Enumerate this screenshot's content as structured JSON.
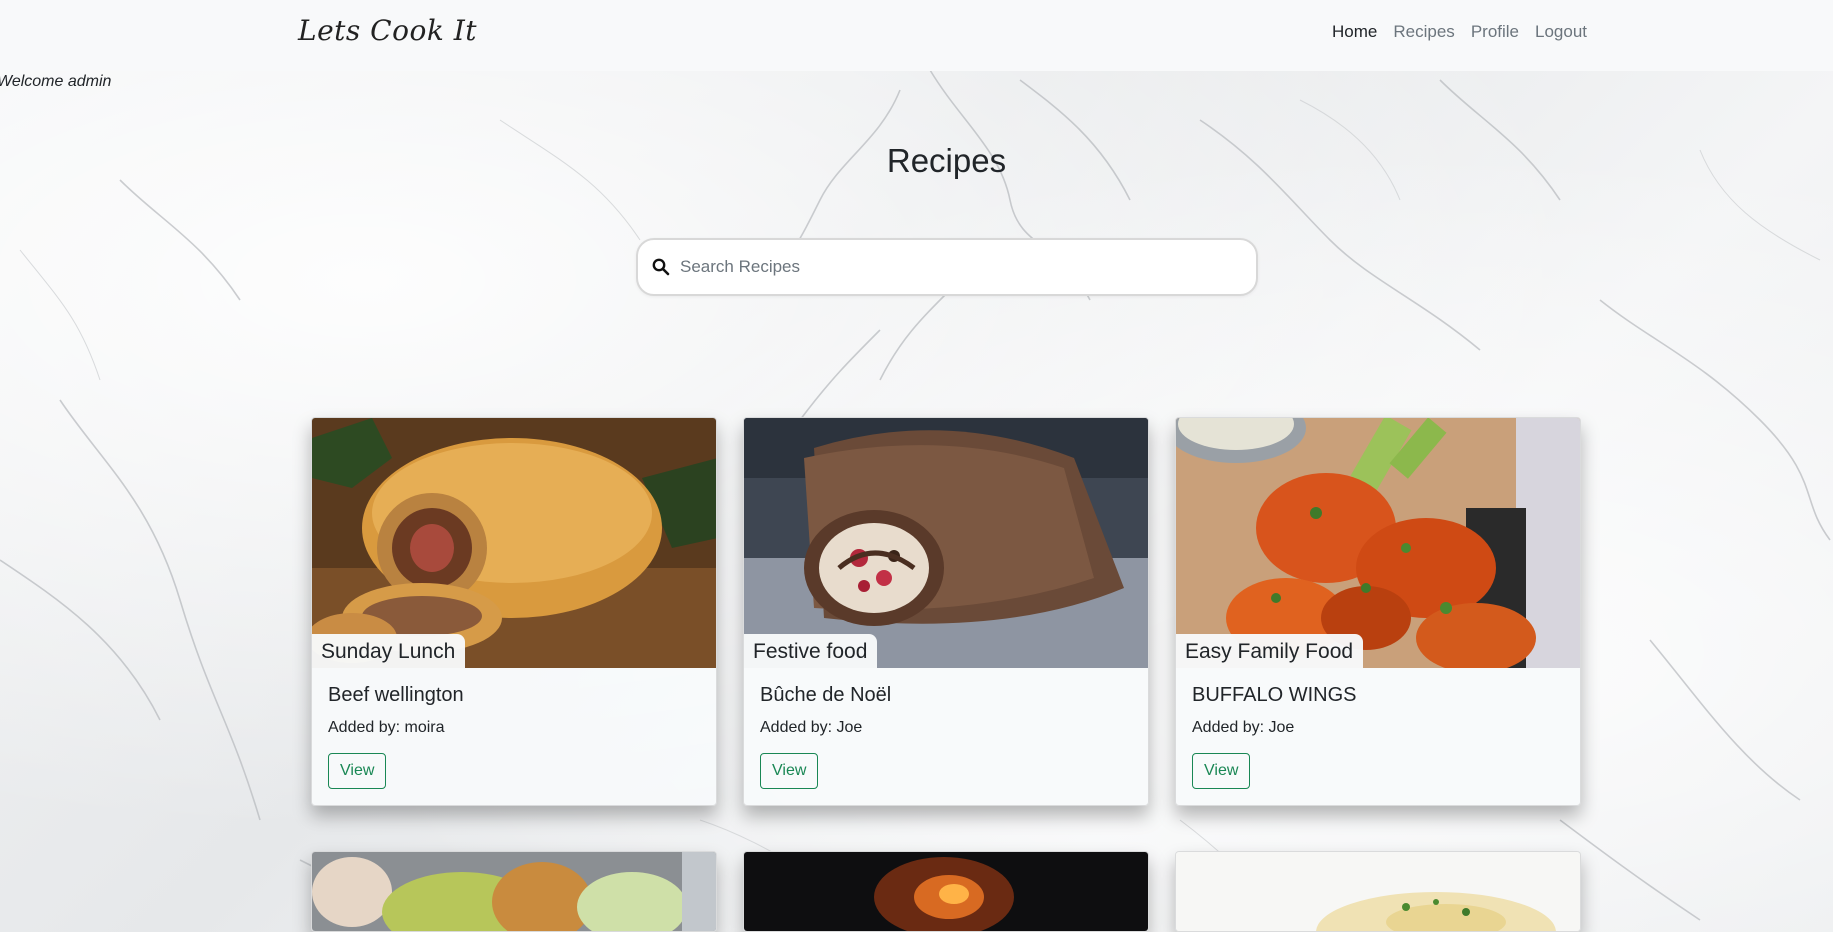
{
  "navbar": {
    "brand": "Lets Cook It",
    "links": [
      {
        "label": "Home",
        "active": true
      },
      {
        "label": "Recipes",
        "active": false
      },
      {
        "label": "Profile",
        "active": false
      },
      {
        "label": "Logout",
        "active": false
      }
    ]
  },
  "welcome": "Welcome admin",
  "page_title": "Recipes",
  "search": {
    "placeholder": "Search Recipes",
    "value": ""
  },
  "recipes": [
    {
      "category": "Sunday Lunch",
      "title": "Beef wellington",
      "added_by": "Added by: moira",
      "button": "View"
    },
    {
      "category": "Festive food",
      "title": "Bûche de Noël",
      "added_by": "Added by: Joe",
      "button": "View"
    },
    {
      "category": "Easy Family Food",
      "title": "BUFFALO WINGS",
      "added_by": "Added by: Joe",
      "button": "View"
    }
  ],
  "colors": {
    "accent": "#198754",
    "navbar_bg": "#f8f9fa",
    "text": "#212529",
    "muted": "#6c757d"
  }
}
